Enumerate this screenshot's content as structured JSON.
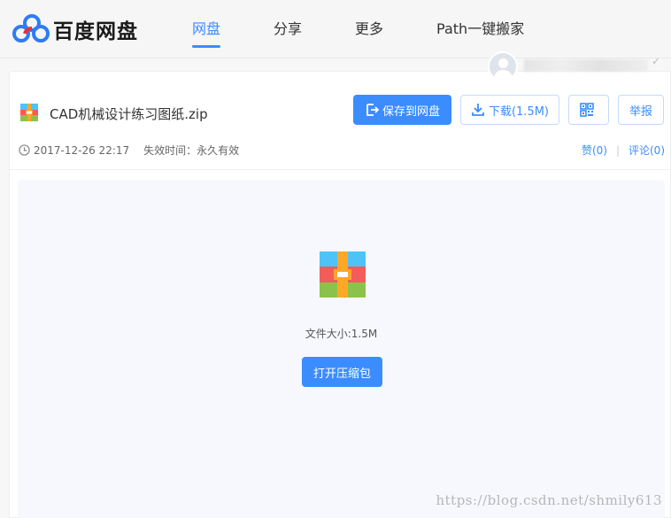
{
  "header": {
    "logo_text": "百度网盘",
    "nav": [
      {
        "label": "网盘",
        "active": true
      },
      {
        "label": "分享",
        "active": false
      },
      {
        "label": "更多",
        "active": false
      },
      {
        "label": "Path一键搬家",
        "active": false
      }
    ]
  },
  "file": {
    "name": "CAD机械设计练习图纸.zip",
    "time": "2017-12-26 22:17",
    "expire": "失效时间：永久有效",
    "size_text": "文件大小:1.5M"
  },
  "toolbar": {
    "save_label": "保存到网盘",
    "download_label": "下载(1.5M)",
    "report_label": "举报"
  },
  "actions": {
    "like_label": "赞(0)",
    "comment_label": "评论(0)"
  },
  "preview": {
    "open_label": "打开压缩包"
  },
  "watermark": "https://blog.csdn.net/shmily613",
  "colors": {
    "accent": "#3b8cff",
    "zip_blue": "#4fc3f7",
    "zip_red": "#f45b5b",
    "zip_green": "#8bc34a",
    "zip_orange": "#ffa726"
  },
  "icons": [
    "baidu-cloud-logo-icon",
    "zip-file-icon",
    "save-icon",
    "download-icon",
    "qrcode-icon",
    "clock-icon",
    "avatar-icon"
  ]
}
